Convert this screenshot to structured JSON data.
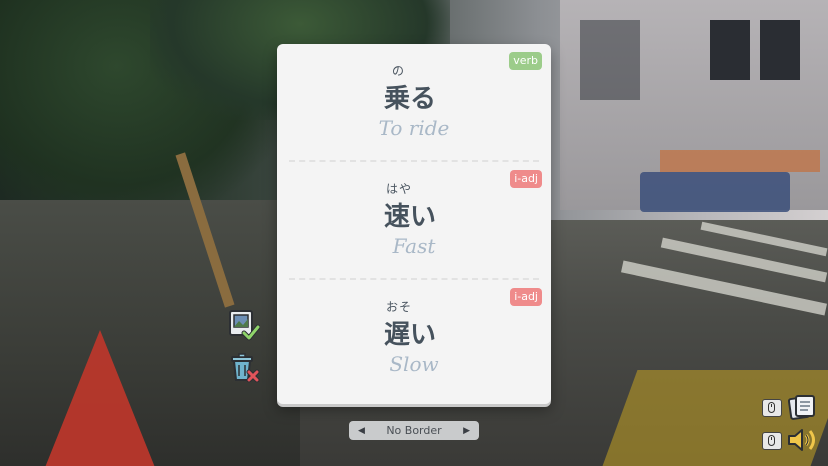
{
  "cards": [
    {
      "furigana": "の",
      "word": "乗る",
      "meaning": "To ride",
      "tag": "verb",
      "tag_color": "#9ccc8a"
    },
    {
      "furigana": "はや",
      "word": "速い",
      "meaning": "Fast",
      "tag": "i-adj",
      "tag_color": "#ef8b8b"
    },
    {
      "furigana": "おそ",
      "word": "遅い",
      "meaning": "Slow",
      "tag": "i-adj",
      "tag_color": "#ef8b8b"
    }
  ],
  "side_actions": {
    "save_icon": "photo-check-icon",
    "discard_icon": "trash-x-icon"
  },
  "border_selector": {
    "label": "No Border",
    "prev_icon": "arrow-left-icon",
    "next_icon": "arrow-right-icon"
  },
  "controls": {
    "notes_icon": "notes-icon",
    "sound_icon": "speaker-icon",
    "mouse_icon": "mouse-icon"
  },
  "colors": {
    "panel": "#f4f4f4",
    "word": "#46525d",
    "meaning": "#a9b8c7"
  }
}
